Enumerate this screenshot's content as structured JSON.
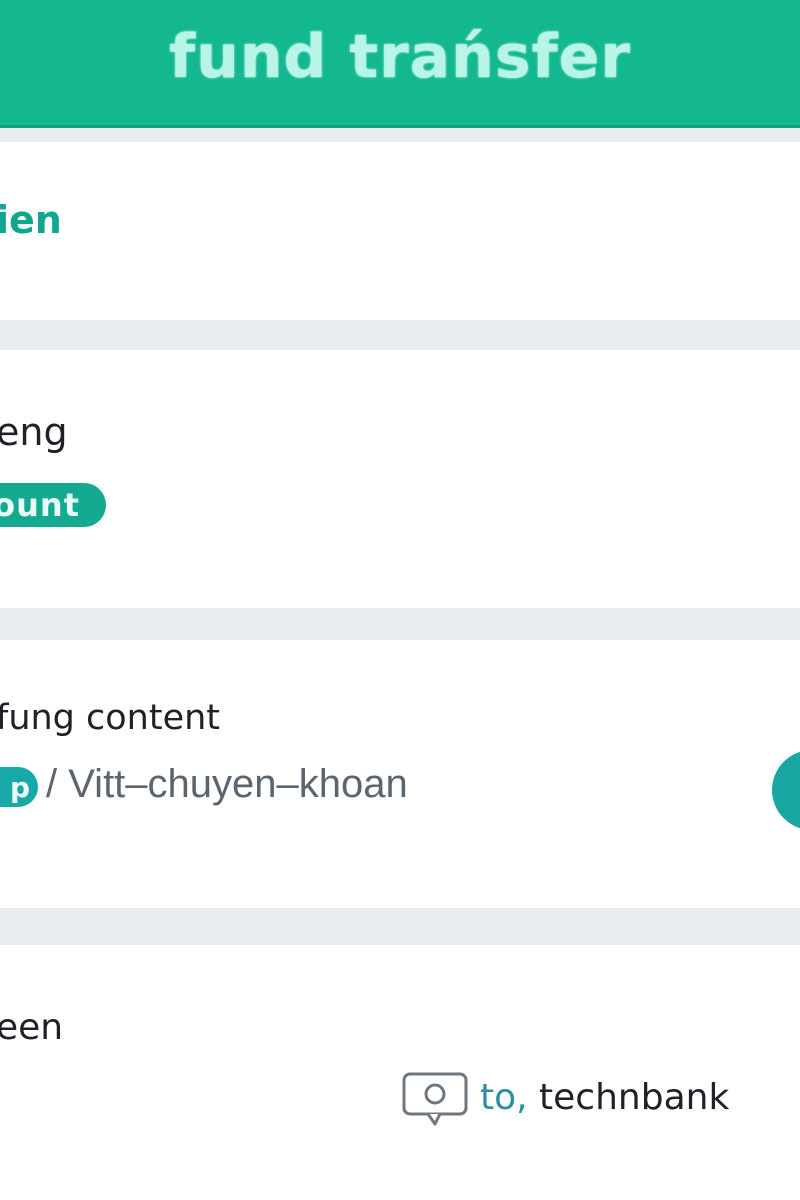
{
  "header": {
    "title": "fund trańsfer"
  },
  "section1": {
    "text": "ien"
  },
  "section2": {
    "title": "eng",
    "badge": "ount"
  },
  "section3": {
    "title": "fung content",
    "badge": "p",
    "path": "/ Vitt–chuyen–khoan"
  },
  "section4": {
    "title": "een",
    "recipient_prefix": "to,",
    "recipient_name": "technbank"
  },
  "icons": {
    "chat": "chat-bubble-icon",
    "action": "action-button"
  },
  "colors": {
    "header": "#14b890",
    "accent": "#14a991",
    "teal": "#1aa6a3"
  }
}
